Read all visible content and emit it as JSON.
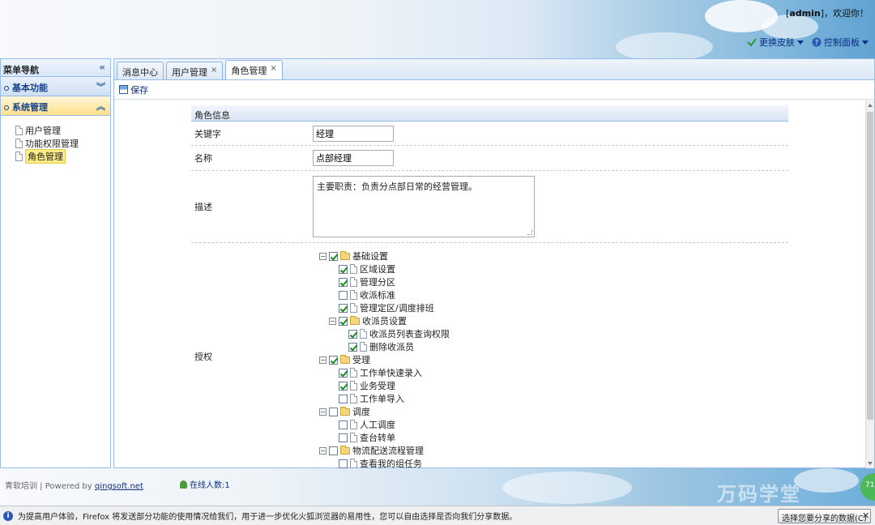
{
  "header": {
    "user_prefix": "[",
    "user_name": "admin",
    "user_suffix": "]，欢迎你！",
    "change_skin": "更换皮肤",
    "control_panel": "控制面板"
  },
  "nav": {
    "title": "菜单导航",
    "collapse_glyph": "«",
    "sections": [
      {
        "label": "基本功能",
        "chevron": "︾"
      },
      {
        "label": "系统管理",
        "chevron": "︽"
      }
    ],
    "items": [
      {
        "label": "用户管理"
      },
      {
        "label": "功能权限管理"
      },
      {
        "label": "角色管理"
      }
    ]
  },
  "tabs": [
    {
      "label": "消息中心",
      "close": ""
    },
    {
      "label": "用户管理",
      "close": "×"
    },
    {
      "label": "角色管理",
      "close": "×"
    }
  ],
  "toolbar": {
    "save_label": "保存"
  },
  "form": {
    "title": "角色信息",
    "keyword_label": "关键字",
    "keyword_value": "经理",
    "name_label": "名称",
    "name_value": "点部经理",
    "desc_label": "描述",
    "desc_value": "主要职责：负责分点部日常的经营管理。",
    "auth_label": "授权"
  },
  "permission_tree": [
    {
      "label": "基础设置",
      "level": 0,
      "type": "folder",
      "checked": true,
      "expander": "⊟"
    },
    {
      "label": "区域设置",
      "level": 1,
      "type": "file",
      "checked": true
    },
    {
      "label": "管理分区",
      "level": 1,
      "type": "file",
      "checked": true
    },
    {
      "label": "收派标准",
      "level": 1,
      "type": "file",
      "checked": false
    },
    {
      "label": "管理定区/调度排班",
      "level": 1,
      "type": "file",
      "checked": true
    },
    {
      "label": "收派员设置",
      "level": 1,
      "type": "folder",
      "checked": true,
      "expander": "⊟"
    },
    {
      "label": "收派员列表查询权限",
      "level": 2,
      "type": "file",
      "checked": true
    },
    {
      "label": "删除收派员",
      "level": 2,
      "type": "file",
      "checked": true
    },
    {
      "label": "受理",
      "level": 0,
      "type": "folder",
      "checked": true,
      "expander": "⊟"
    },
    {
      "label": "工作单快速录入",
      "level": 1,
      "type": "file",
      "checked": true
    },
    {
      "label": "业务受理",
      "level": 1,
      "type": "file",
      "checked": true
    },
    {
      "label": "工作单导入",
      "level": 1,
      "type": "file",
      "checked": false
    },
    {
      "label": "调度",
      "level": 0,
      "type": "folder",
      "checked": false,
      "expander": "⊟"
    },
    {
      "label": "人工调度",
      "level": 1,
      "type": "file",
      "checked": false
    },
    {
      "label": "查台转单",
      "level": 1,
      "type": "file",
      "checked": false
    },
    {
      "label": "物流配送流程管理",
      "level": 0,
      "type": "folder",
      "checked": false,
      "expander": "⊟"
    },
    {
      "label": "查看我的组任务",
      "level": 1,
      "type": "file",
      "checked": false
    }
  ],
  "footer": {
    "powered_prefix": "青软培训 | Powered by ",
    "powered_link": "qingsoft.net",
    "online": "在线人数:1",
    "watermark": "万码学堂",
    "badge": "71"
  },
  "notification": {
    "icon": "i",
    "text": "为提高用户体验，Firefox 将发送部分功能的使用情况给我们，用于进一步优化火狐浏览器的易用性，您可以自由选择是否向我们分享数据。",
    "button": "选择您要分享的数据(C)",
    "close": "✕"
  }
}
